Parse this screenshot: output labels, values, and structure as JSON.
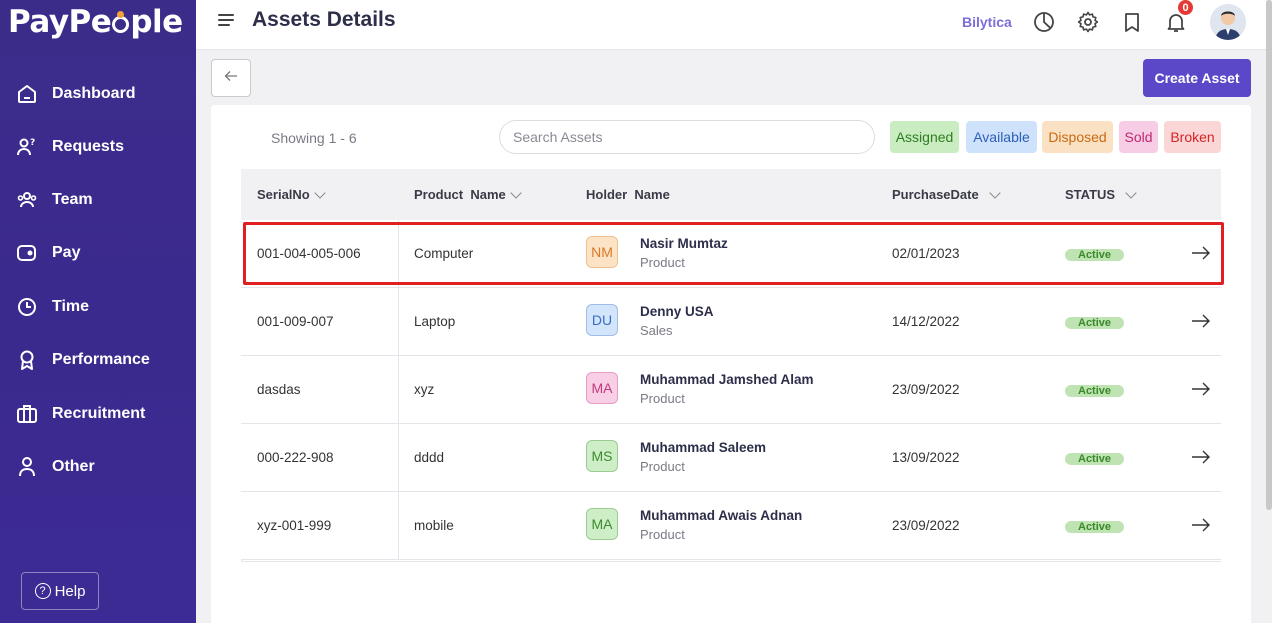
{
  "app": {
    "logo_text_pre": "PayPe",
    "logo_text_post": "ple"
  },
  "sidebar": {
    "items": [
      {
        "label": "Dashboard",
        "icon": "home-icon"
      },
      {
        "label": "Requests",
        "icon": "user-question-icon"
      },
      {
        "label": "Team",
        "icon": "team-icon"
      },
      {
        "label": "Pay",
        "icon": "wallet-icon"
      },
      {
        "label": "Time",
        "icon": "clock-icon"
      },
      {
        "label": "Performance",
        "icon": "award-icon"
      },
      {
        "label": "Recruitment",
        "icon": "briefcase-icon"
      },
      {
        "label": "Other",
        "icon": "person-icon"
      }
    ],
    "help_label": "Help"
  },
  "header": {
    "title": "Assets Details",
    "brand_link": "Bilytica",
    "notification_count": "0"
  },
  "actions": {
    "create_label": "Create Asset",
    "back_icon": "arrow-left-icon"
  },
  "filters": {
    "showing": "Showing 1 - 6",
    "search_placeholder": "Search Assets",
    "chips": [
      {
        "label": "Assigned",
        "bg": "#c9ecc0",
        "color": "#2f7d22"
      },
      {
        "label": "Available",
        "bg": "#cfe2fb",
        "color": "#2c5fb8"
      },
      {
        "label": "Disposed",
        "bg": "#fbe1c3",
        "color": "#c86a12"
      },
      {
        "label": "Sold",
        "bg": "#f7cde6",
        "color": "#c0296f"
      },
      {
        "label": "Broken",
        "bg": "#fbd6d6",
        "color": "#d42424"
      }
    ]
  },
  "table": {
    "columns": [
      "SerialNo",
      "Product  Name",
      "Holder  Name",
      "PurchaseDate",
      "STATUS"
    ],
    "rows": [
      {
        "serial": "001-004-005-006",
        "product": "Computer",
        "initials": "NM",
        "initials_bg": "#fde3c5",
        "initials_color": "#d87a2a",
        "holder": "Nasir Mumtaz",
        "dept": "Product",
        "date": "02/01/2023",
        "status": "Active"
      },
      {
        "serial": "001-009-007",
        "product": "Laptop",
        "initials": "DU",
        "initials_bg": "#d3e5fb",
        "initials_color": "#3c6fc0",
        "holder": "Denny USA",
        "dept": "Sales",
        "date": "14/12/2022",
        "status": "Active"
      },
      {
        "serial": "dasdas",
        "product": "xyz",
        "initials": "MA",
        "initials_bg": "#f8cfe5",
        "initials_color": "#c23a7e",
        "holder": "Muhammad Jamshed Alam",
        "dept": "Product",
        "date": "23/09/2022",
        "status": "Active"
      },
      {
        "serial": "000-222-908",
        "product": "dddd",
        "initials": "MS",
        "initials_bg": "#cdeec6",
        "initials_color": "#3d8a2f",
        "holder": "Muhammad Saleem",
        "dept": "Product",
        "date": "13/09/2022",
        "status": "Active"
      },
      {
        "serial": "xyz-001-999",
        "product": "mobile",
        "initials": "MA",
        "initials_bg": "#cdeec6",
        "initials_color": "#3d8a2f",
        "holder": "Muhammad Awais Adnan",
        "dept": "Product",
        "date": "23/09/2022",
        "status": "Active"
      }
    ]
  },
  "colors": {
    "sidebar": "#3b2a8e",
    "accent": "#5b48c9",
    "highlight": "#e02020"
  }
}
